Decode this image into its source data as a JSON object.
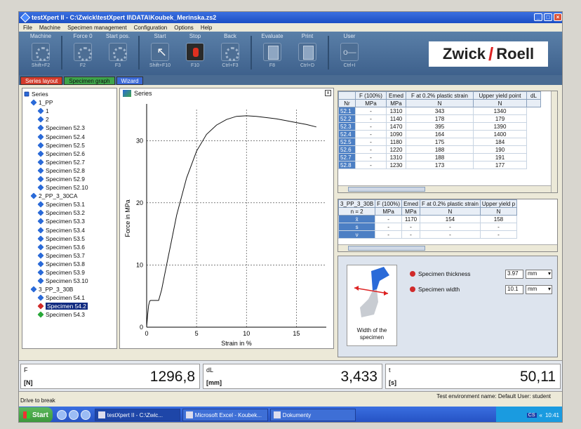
{
  "window": {
    "title": "testXpert II - C:\\Zwick\\testXpert II\\DATA\\Koubek_Merinska.zs2",
    "buttons": [
      "_",
      "□",
      "×"
    ]
  },
  "menu": [
    "File",
    "Machine",
    "Specimen management",
    "Configuration",
    "Options",
    "Help"
  ],
  "toolbar": [
    {
      "label": "Machine",
      "key": "Shift+F2",
      "icon": "gear-icon"
    },
    {
      "label": "Force 0",
      "key": "F2",
      "icon": "gear-icon"
    },
    {
      "label": "Start pos.",
      "key": "F3",
      "icon": "gear-icon"
    },
    {
      "label": "Start",
      "key": "Shift+F10",
      "icon": "cursor-icon"
    },
    {
      "label": "Stop",
      "key": "F10",
      "icon": "stop-icon"
    },
    {
      "label": "Back",
      "key": "Ctrl+F3",
      "icon": "gear-icon"
    },
    {
      "label": "Evaluate",
      "key": "F8",
      "icon": "document-icon"
    },
    {
      "label": "Print",
      "key": "Ctrl+D",
      "icon": "printer-icon"
    },
    {
      "label": "User",
      "key": "Ctrl+I",
      "icon": "user-icon"
    }
  ],
  "logo": {
    "left": "Zwick",
    "slash": "/",
    "right": "Roell"
  },
  "tabs": [
    "Series layout",
    "Specimen graph",
    "Wizard"
  ],
  "tree": [
    {
      "label": "Series",
      "level": 0,
      "type": "group"
    },
    {
      "label": "1_PP",
      "level": 1,
      "type": "blue"
    },
    {
      "label": "1",
      "level": 2,
      "type": "blue"
    },
    {
      "label": "2",
      "level": 2,
      "type": "blue"
    },
    {
      "label": "Specimen 52.3",
      "level": 2,
      "type": "blue"
    },
    {
      "label": "Specimen 52.4",
      "level": 2,
      "type": "blue"
    },
    {
      "label": "Specimen 52.5",
      "level": 2,
      "type": "blue"
    },
    {
      "label": "Specimen 52.6",
      "level": 2,
      "type": "blue"
    },
    {
      "label": "Specimen 52.7",
      "level": 2,
      "type": "blue"
    },
    {
      "label": "Specimen 52.8",
      "level": 2,
      "type": "blue"
    },
    {
      "label": "Specimen 52.9",
      "level": 2,
      "type": "blue"
    },
    {
      "label": "Specimen 52.10",
      "level": 2,
      "type": "blue"
    },
    {
      "label": "2_PP_3_30CA",
      "level": 1,
      "type": "blue"
    },
    {
      "label": "Specimen 53.1",
      "level": 2,
      "type": "blue"
    },
    {
      "label": "Specimen 53.2",
      "level": 2,
      "type": "blue"
    },
    {
      "label": "Specimen 53.3",
      "level": 2,
      "type": "blue"
    },
    {
      "label": "Specimen 53.4",
      "level": 2,
      "type": "blue"
    },
    {
      "label": "Specimen 53.5",
      "level": 2,
      "type": "blue"
    },
    {
      "label": "Specimen 53.6",
      "level": 2,
      "type": "blue"
    },
    {
      "label": "Specimen 53.7",
      "level": 2,
      "type": "blue"
    },
    {
      "label": "Specimen 53.8",
      "level": 2,
      "type": "blue"
    },
    {
      "label": "Specimen 53.9",
      "level": 2,
      "type": "blue"
    },
    {
      "label": "Specimen 53.10",
      "level": 2,
      "type": "blue"
    },
    {
      "label": "3_PP_3_30B",
      "level": 1,
      "type": "blue"
    },
    {
      "label": "Specimen 54.1",
      "level": 2,
      "type": "blue"
    },
    {
      "label": "Specimen 54.2",
      "level": 2,
      "type": "red",
      "selected": true
    },
    {
      "label": "Specimen 54.3",
      "level": 2,
      "type": "green"
    }
  ],
  "graph": {
    "title": "Series",
    "close": "x"
  },
  "chart_data": {
    "type": "line",
    "title": "Series",
    "xlabel": "Strain in %",
    "ylabel": "Force in MPa",
    "xlim": [
      0,
      18
    ],
    "ylim": [
      0,
      35
    ],
    "xticks": [
      0,
      5,
      10,
      15
    ],
    "yticks": [
      0,
      10,
      20,
      30
    ],
    "grid": true,
    "series": [
      {
        "x": [
          0,
          0.1,
          0.2,
          0.3,
          0.4,
          0.5,
          0.8,
          1.2,
          1.5,
          2,
          2.5,
          3,
          3.5,
          4,
          5,
          6,
          7,
          8,
          9,
          10,
          11,
          12,
          13,
          14,
          15,
          16,
          17
        ],
        "y": [
          0,
          2,
          3.5,
          4.2,
          4.3,
          4.3,
          4.3,
          4.3,
          6,
          10,
          14,
          18,
          21,
          24,
          28.3,
          31,
          32.5,
          33.4,
          33.9,
          34.0,
          33.9,
          33.7,
          33.5,
          33.2,
          32.9,
          32.6,
          32.2
        ]
      }
    ]
  },
  "table1": {
    "headers": [
      [
        "",
        "F (100%)",
        "Emed",
        "F at 0.2% plastic strain",
        "Upper yield point",
        "dL"
      ],
      [
        "Nr",
        "MPa",
        "MPa",
        "N",
        "N",
        ""
      ]
    ],
    "rows": [
      [
        "52.1",
        "-",
        "1310",
        "343",
        "1340"
      ],
      [
        "52.2",
        "-",
        "1140",
        "178",
        "179"
      ],
      [
        "52.3",
        "-",
        "1470",
        "395",
        "1390"
      ],
      [
        "52.4",
        "-",
        "1090",
        "164",
        "1400"
      ],
      [
        "52.5",
        "-",
        "1180",
        "175",
        "184"
      ],
      [
        "52.6",
        "-",
        "1220",
        "188",
        "190"
      ],
      [
        "52.7",
        "-",
        "1310",
        "188",
        "191"
      ],
      [
        "52.8",
        "-",
        "1230",
        "173",
        "177"
      ]
    ]
  },
  "table2": {
    "headers": [
      [
        "3_PP_3_30B",
        "F (100%)",
        "Emed",
        "F at 0.2% plastic strain",
        "Upper yield p"
      ],
      [
        "n = 2",
        "MPa",
        "MPa",
        "N",
        "N"
      ]
    ],
    "rows": [
      [
        "x̄",
        "-",
        "1170",
        "154",
        "158"
      ],
      [
        "s",
        "-",
        "-",
        "-",
        "-"
      ],
      [
        "ν",
        "-",
        "-",
        "-",
        "-"
      ]
    ]
  },
  "params": {
    "caption": "Width of the specimen",
    "thickness": {
      "label": "Specimen thickness",
      "value": "3.97",
      "unit": "mm"
    },
    "width": {
      "label": "Specimen width",
      "value": "10.1",
      "unit": "mm"
    }
  },
  "readouts": [
    {
      "label": "F",
      "unit": "[N]",
      "value": "1296,8"
    },
    {
      "label": "dL",
      "unit": "[mm]",
      "value": "3,433"
    },
    {
      "label": "t",
      "unit": "[s]",
      "value": "50,11"
    }
  ],
  "status": {
    "left": "Drive to break",
    "right": "Test environment name: Default   User: student"
  },
  "taskbar": {
    "start": "Start",
    "tasks": [
      "testXpert II - C:\\Zwic...",
      "Microsoft Excel - Koubek...",
      "Dokumenty"
    ],
    "lang": "CS",
    "time": "10:41"
  }
}
